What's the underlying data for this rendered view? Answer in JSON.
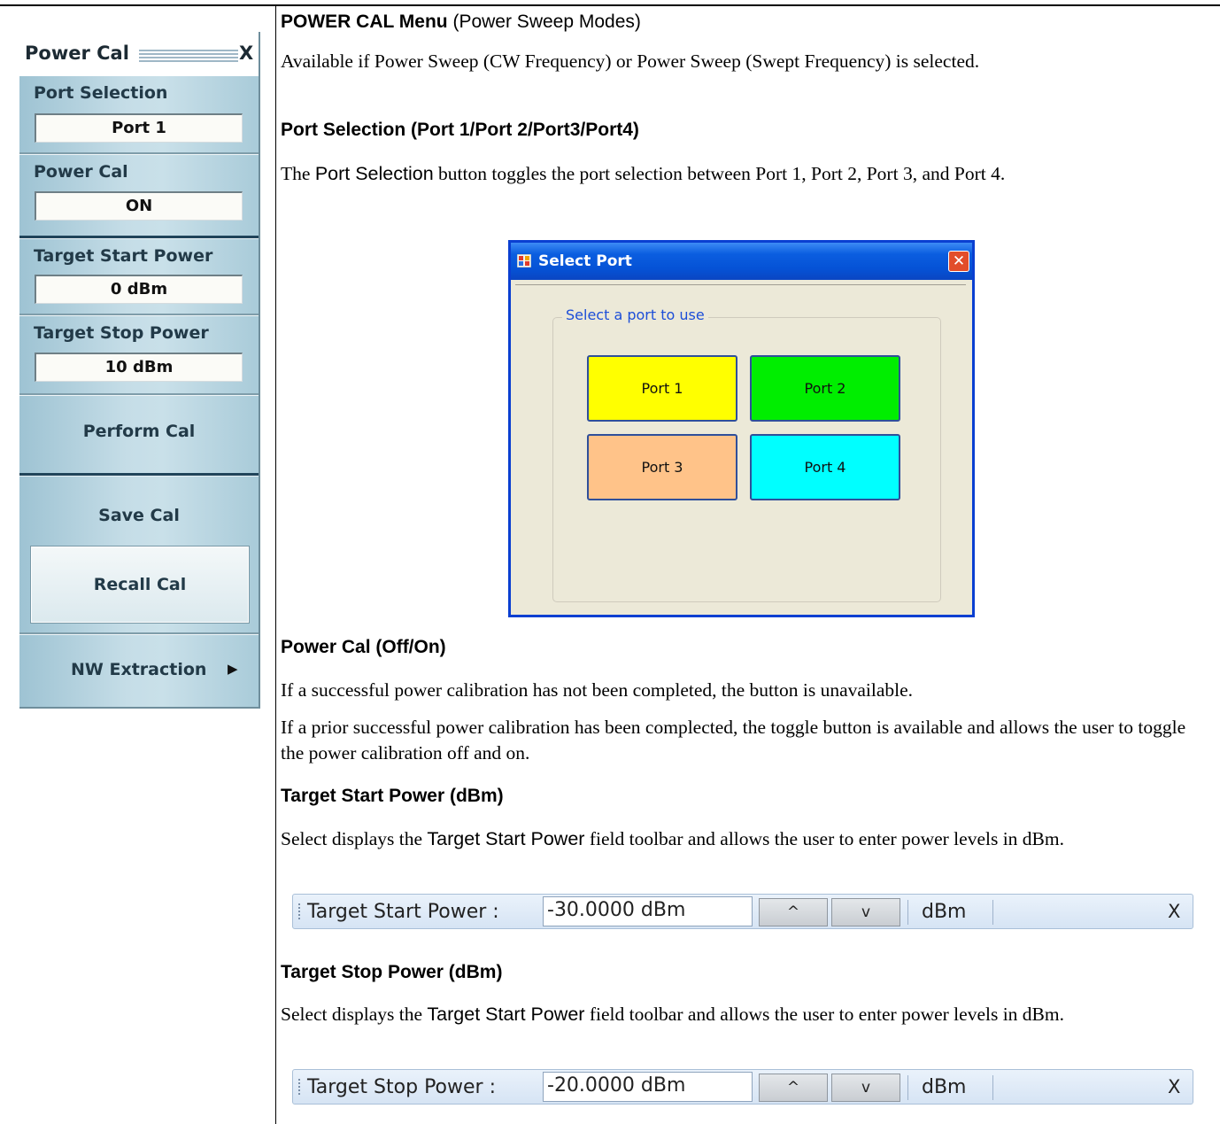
{
  "menu": {
    "title": "Power Cal",
    "close": "X",
    "port_selection_label": "Port Selection",
    "port_selection_value": "Port 1",
    "power_cal_label": "Power Cal",
    "power_cal_value": "ON",
    "target_start_label": "Target Start Power",
    "target_start_value": "0  dBm",
    "target_stop_label": "Target Stop Power",
    "target_stop_value": "10  dBm",
    "perform_cal": "Perform  Cal",
    "save_cal": "Save Cal",
    "recall_cal": "Recall Cal",
    "nw_extraction": "NW Extraction",
    "nw_arrow": "▶"
  },
  "content": {
    "heading1_bold": "POWER CAL Menu",
    "heading1_rest": " (Power Sweep Modes)",
    "para1": "Available if Power Sweep (CW Frequency) or Power Sweep (Swept Frequency) is selected.",
    "heading2": "Port Selection (Port 1/Port 2/Port3/Port4)",
    "para2_pre": "The ",
    "para2_term": "Port Selection",
    "para2_post": " button toggles the port selection between Port 1, Port 2, Port 3, and Port 4.",
    "heading3": "Power Cal (Off/On)",
    "para3": "If a successful power calibration has not been completed, the button is unavailable.",
    "para4": "If a prior successful power calibration has been complected, the toggle button is available and allows the user to toggle the power calibration off and on.",
    "heading4": "Target Start Power (dBm)",
    "para5_pre": "Select displays the ",
    "para5_term": "Target Start Power",
    "para5_post": " field toolbar and allows the user to enter power levels in dBm.",
    "heading5": "Target Stop Power (dBm)",
    "para6_pre": "Select displays the ",
    "para6_term": "Target Start Power",
    "para6_post": " field toolbar and allows the user to enter power levels in dBm."
  },
  "dialog": {
    "title": "Select Port",
    "close": "✕",
    "group_label": "Select a port to use",
    "ports": [
      {
        "label": "Port 1",
        "color": "#ffff00"
      },
      {
        "label": "Port 2",
        "color": "#00ee00"
      },
      {
        "label": "Port 3",
        "color": "#ffc389"
      },
      {
        "label": "Port 4",
        "color": "#00ffff"
      }
    ]
  },
  "toolbar_start": {
    "label": "Target Start Power  :",
    "value": "-30.0000  dBm",
    "up": "^",
    "down": "v",
    "unit": "dBm",
    "close": "X"
  },
  "toolbar_stop": {
    "label": "Target Stop Power  :",
    "value": "-20.0000  dBm",
    "up": "^",
    "down": "v",
    "unit": "dBm",
    "close": "X"
  }
}
